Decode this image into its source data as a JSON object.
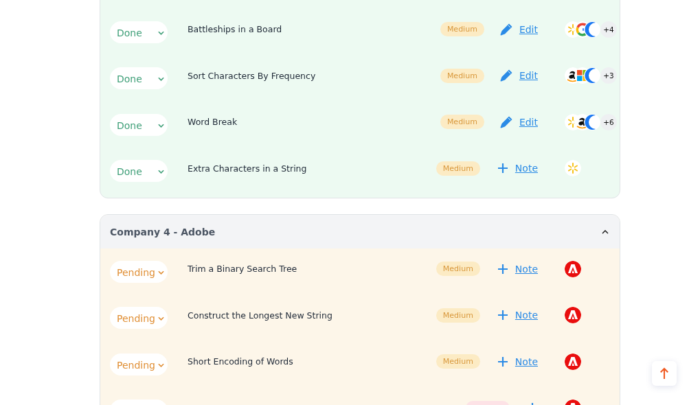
{
  "sections": [
    {
      "kind": "done",
      "rows": [
        {
          "status": "Done",
          "title": "Battleships in a Board",
          "difficulty": {
            "kind": "medium",
            "label": "Medium"
          },
          "action": {
            "kind": "edit",
            "label": "Edit"
          },
          "logos": [
            {
              "kind": "spark"
            },
            {
              "kind": "ring"
            },
            {
              "kind": "crescent"
            }
          ],
          "more": "+4"
        },
        {
          "status": "Done",
          "title": "Sort Characters By Frequency",
          "difficulty": {
            "kind": "medium",
            "label": "Medium"
          },
          "action": {
            "kind": "edit",
            "label": "Edit"
          },
          "logos": [
            {
              "kind": "smile"
            },
            {
              "kind": "squares"
            },
            {
              "kind": "crescent"
            }
          ],
          "more": "+3"
        },
        {
          "status": "Done",
          "title": "Word Break",
          "difficulty": {
            "kind": "medium",
            "label": "Medium"
          },
          "action": {
            "kind": "edit",
            "label": "Edit"
          },
          "logos": [
            {
              "kind": "spark"
            },
            {
              "kind": "smile"
            },
            {
              "kind": "crescent"
            }
          ],
          "more": "+6"
        },
        {
          "status": "Done",
          "title": "Extra Characters in a String",
          "difficulty": {
            "kind": "medium",
            "label": "Medium"
          },
          "action": {
            "kind": "note",
            "label": "Note"
          },
          "logos": [
            {
              "kind": "spark"
            }
          ]
        }
      ]
    },
    {
      "kind": "pending",
      "header": {
        "title": "Company 4 - Adobe",
        "expanded": true
      },
      "rows": [
        {
          "status": "Pending",
          "title": "Trim a Binary Search Tree",
          "difficulty": {
            "kind": "medium",
            "label": "Medium"
          },
          "action": {
            "kind": "note",
            "label": "Note"
          },
          "logos": [
            {
              "kind": "triangle"
            }
          ]
        },
        {
          "status": "Pending",
          "title": "Construct the Longest New String",
          "difficulty": {
            "kind": "medium",
            "label": "Medium"
          },
          "action": {
            "kind": "note",
            "label": "Note"
          },
          "logos": [
            {
              "kind": "triangle"
            }
          ]
        },
        {
          "status": "Pending",
          "title": "Short Encoding of Words",
          "difficulty": {
            "kind": "medium",
            "label": "Medium"
          },
          "action": {
            "kind": "note",
            "label": "Note"
          },
          "logos": [
            {
              "kind": "triangle"
            }
          ]
        },
        {
          "difficulty": {
            "kind": "hard"
          },
          "action": {
            "kind": "note"
          },
          "logos": [
            {
              "kind": "triangle"
            }
          ]
        }
      ]
    }
  ]
}
